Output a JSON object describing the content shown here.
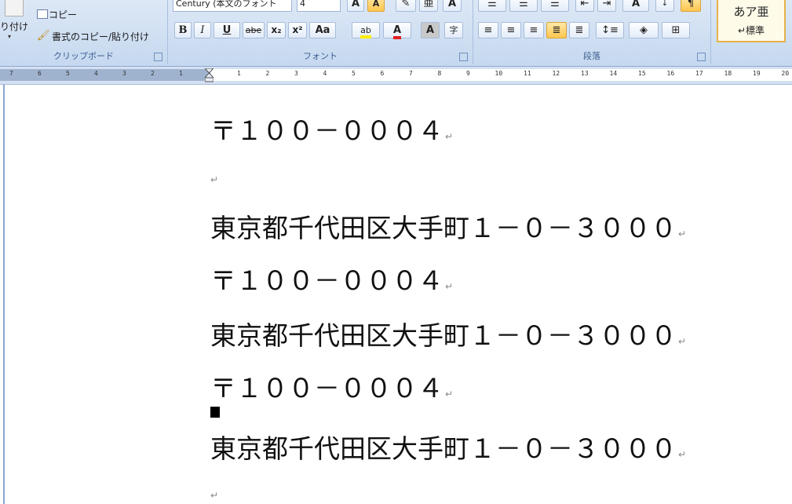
{
  "ribbon": {
    "clipboard": {
      "paste_label": "り付け",
      "copy_label": "コピー",
      "format_painter_label": "書式のコピー/貼り付け",
      "group_label": "クリップボード"
    },
    "font": {
      "font_name": "Century (本文のフォント",
      "font_size": "4",
      "bold": "B",
      "italic": "I",
      "underline": "U",
      "strike": "abe",
      "subscript": "x₂",
      "superscript": "x²",
      "change_case": "Aa",
      "highlight": "ab",
      "font_color": "A",
      "char_shading": "A",
      "enclose": "字",
      "grow": "A",
      "shrink": "A",
      "group_label": "フォント"
    },
    "paragraph": {
      "group_label": "段落"
    },
    "styles": {
      "sample": "あア亜",
      "standard_label": "↵標準"
    }
  },
  "ruler": {
    "left_ticks": [
      "7",
      "6",
      "5",
      "4",
      "3",
      "2",
      "1"
    ],
    "right_ticks": [
      "1",
      "2",
      "3",
      "4",
      "5",
      "6",
      "7",
      "8",
      "9",
      "10",
      "11",
      "12",
      "13",
      "14",
      "15",
      "16",
      "17",
      "18",
      "19",
      "20"
    ]
  },
  "document": {
    "lines": [
      {
        "text": "〒１００－０００４",
        "kind": "zip"
      },
      {
        "text": "東京都千代田区大手町１－０－３０００",
        "kind": "addr"
      },
      {
        "text": "〒１００－０００４",
        "kind": "zip"
      },
      {
        "text": "東京都千代田区大手町１－０－３０００",
        "kind": "addr"
      },
      {
        "text": "〒１００－０００４",
        "kind": "zip"
      },
      {
        "text": "東京都千代田区大手町１－０－３０００",
        "kind": "addr"
      }
    ],
    "paragraph_mark": "↵"
  },
  "colors": {
    "ribbon_bg": "#c5d8ef",
    "highlight_button": "#ffc64f",
    "font_color_red": "#e02020",
    "highlight_yellow": "#ffee00"
  }
}
